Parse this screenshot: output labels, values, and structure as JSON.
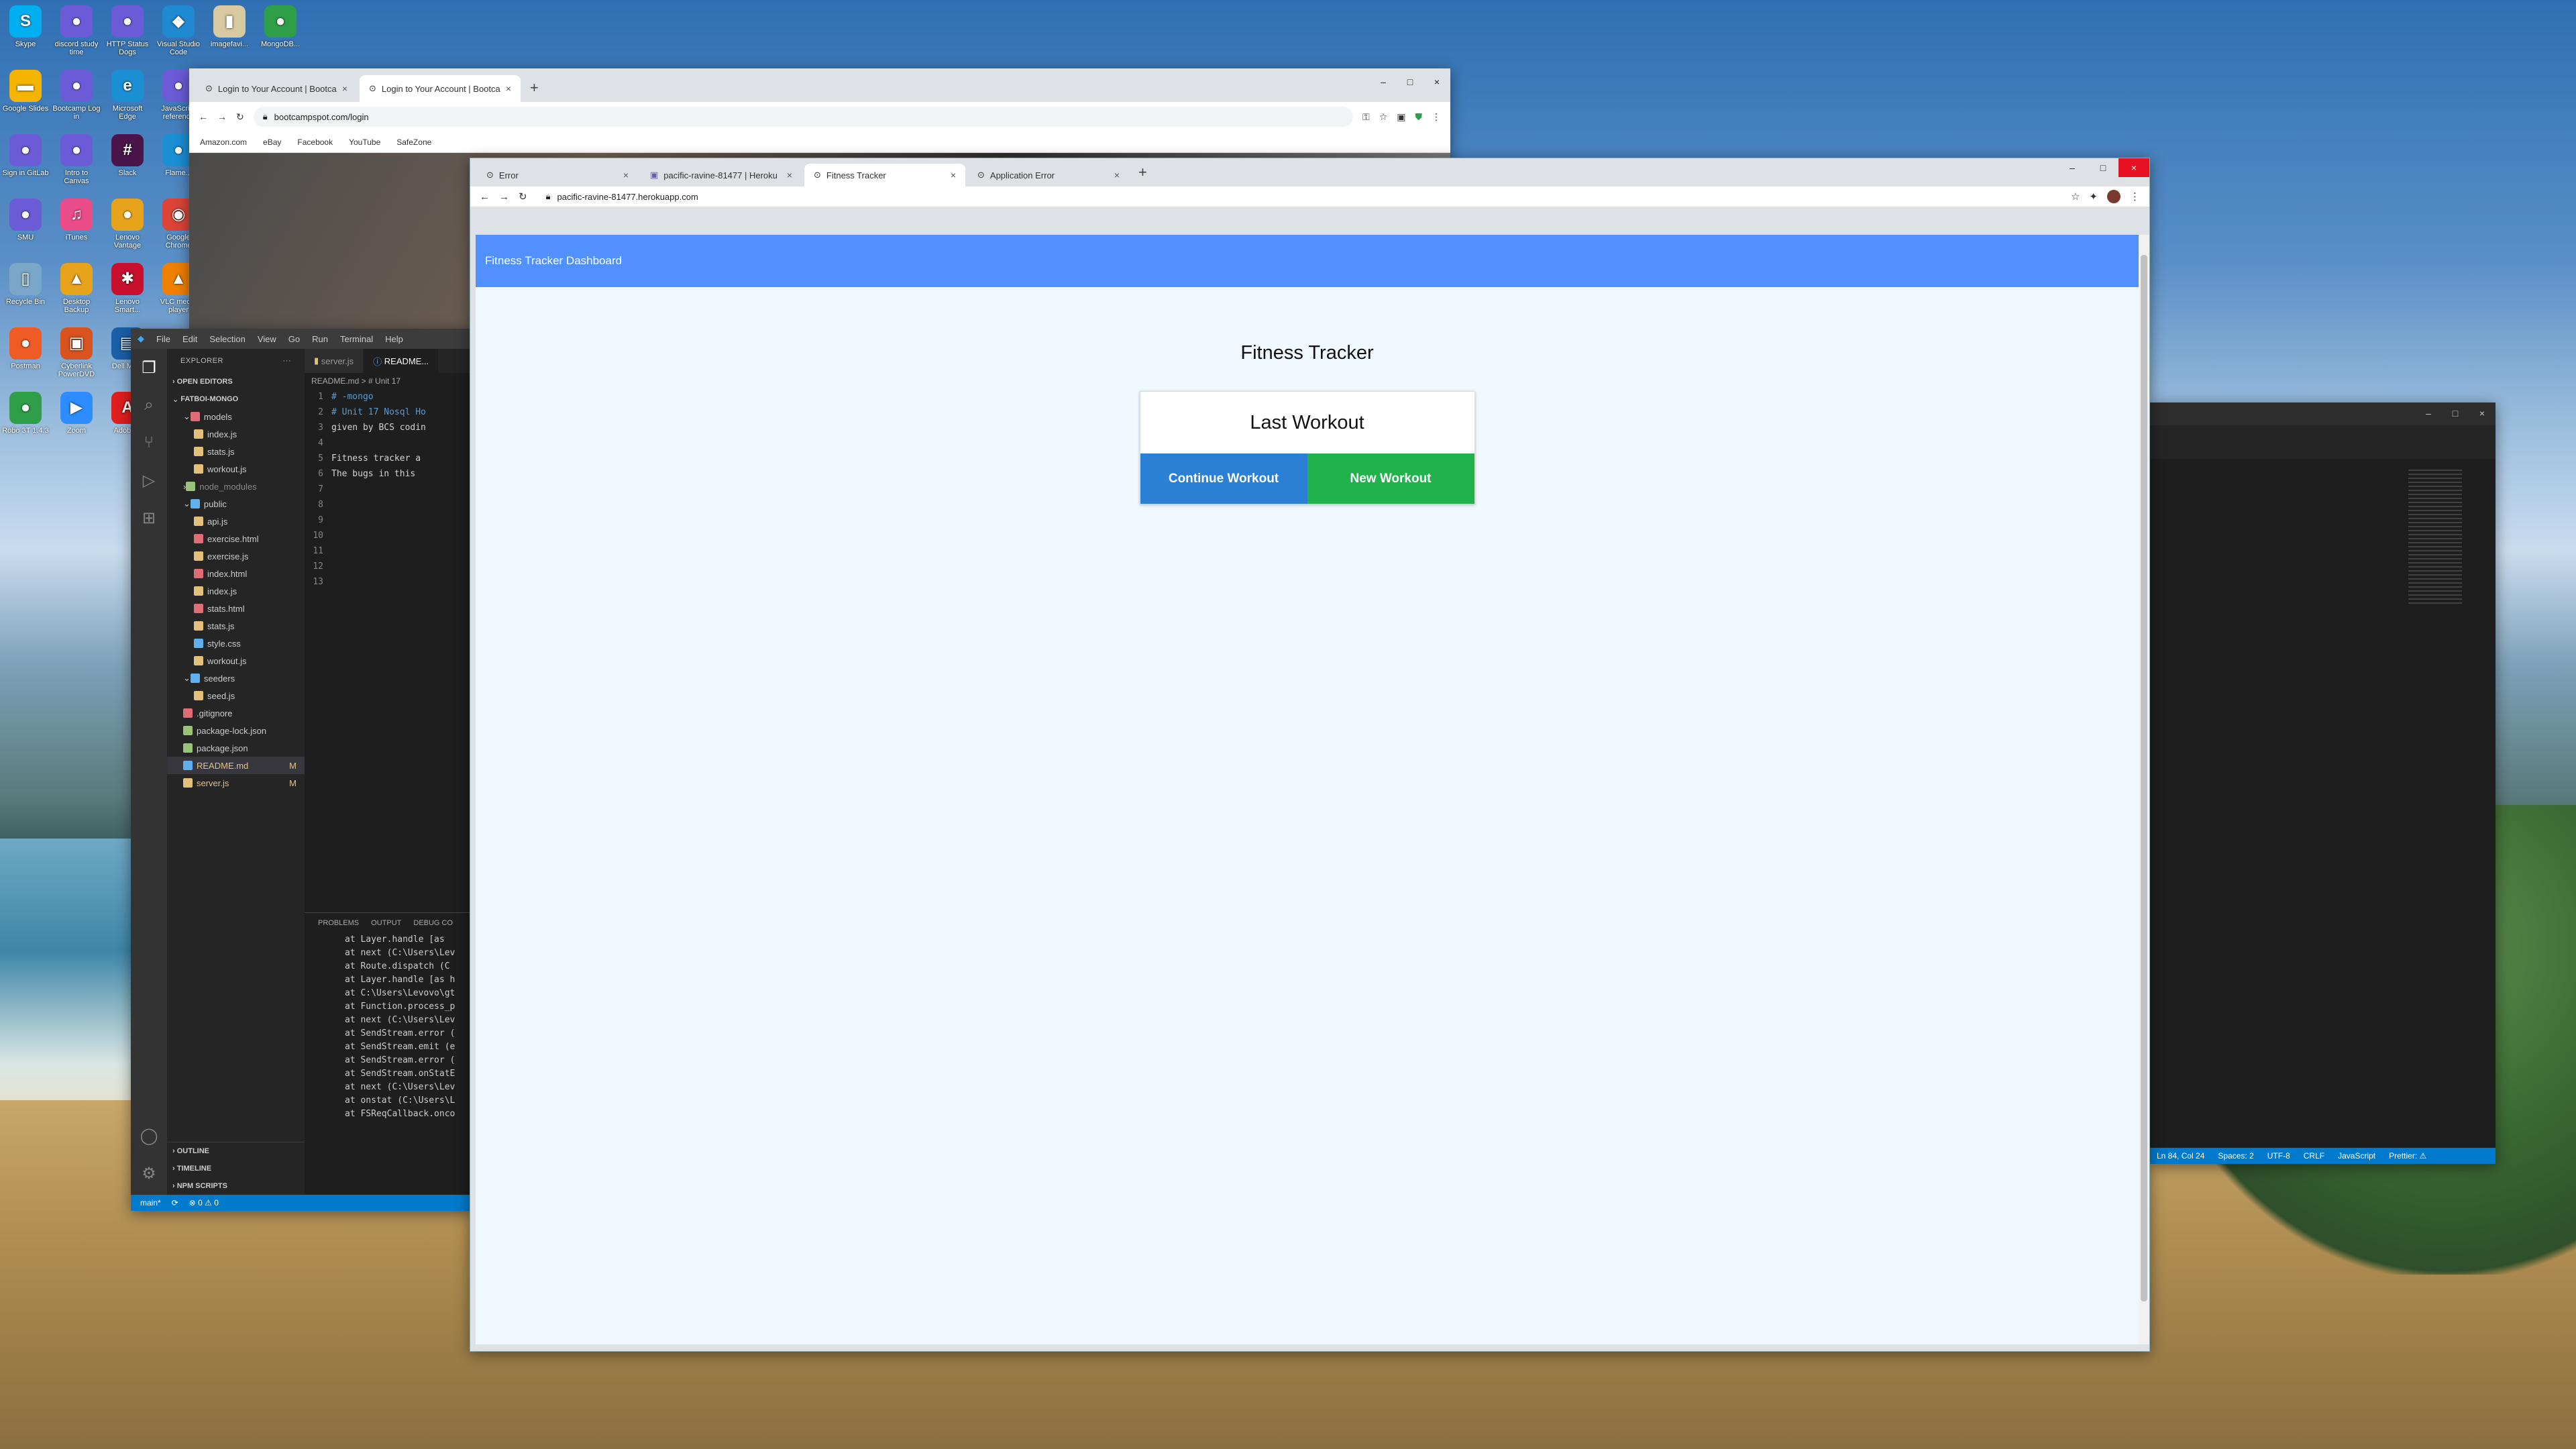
{
  "desktop": {
    "icons": [
      {
        "label": "Skype",
        "glyph": "S",
        "color": "#00aff0"
      },
      {
        "label": "discord study time",
        "glyph": "●",
        "color": "#6b5bd6"
      },
      {
        "label": "HTTP Status Dogs",
        "glyph": "●",
        "color": "#6b5bd6"
      },
      {
        "label": "Visual Studio Code",
        "glyph": "◆",
        "color": "#1f8ad2"
      },
      {
        "label": "imagefavi...",
        "glyph": "▮",
        "color": "#d9c9a0"
      },
      {
        "label": "MongoDB...",
        "glyph": "●",
        "color": "#2e9e48"
      },
      {
        "label": "Google Slides",
        "glyph": "▬",
        "color": "#f4b400"
      },
      {
        "label": "Bootcamp Log in",
        "glyph": "●",
        "color": "#6b5bd6"
      },
      {
        "label": "Microsoft Edge",
        "glyph": "e",
        "color": "#1a8fd4"
      },
      {
        "label": "JavaScript reference",
        "glyph": "●",
        "color": "#6b5bd6"
      },
      {
        "label": "Sign in GitLab",
        "glyph": "●",
        "color": "#6b5bd6"
      },
      {
        "label": "Intro to Canvas",
        "glyph": "●",
        "color": "#6b5bd6"
      },
      {
        "label": "Slack",
        "glyph": "#",
        "color": "#4a154b"
      },
      {
        "label": "Flame...",
        "glyph": "●",
        "color": "#1a8fd4"
      },
      {
        "label": "SMU",
        "glyph": "●",
        "color": "#6b5bd6"
      },
      {
        "label": "iTunes",
        "glyph": "♫",
        "color": "#ea4c89"
      },
      {
        "label": "Lenovo Vantage",
        "glyph": "●",
        "color": "#e8a31c"
      },
      {
        "label": "Google Chrome",
        "glyph": "◉",
        "color": "#db4437"
      },
      {
        "label": "Recycle Bin",
        "glyph": "▯",
        "color": "#7aa7c7"
      },
      {
        "label": "Desktop Backup",
        "glyph": "▲",
        "color": "#e8a31c"
      },
      {
        "label": "Lenovo Smart...",
        "glyph": "✱",
        "color": "#c8102e"
      },
      {
        "label": "VLC media player",
        "glyph": "▲",
        "color": "#f08000"
      },
      {
        "label": "Postman",
        "glyph": "●",
        "color": "#ef5b25"
      },
      {
        "label": "Cyberlink PowerDVD",
        "glyph": "▣",
        "color": "#d9531e"
      },
      {
        "label": "Dell Mo...",
        "glyph": "▤",
        "color": "#1a5fa8"
      },
      {
        "label": "Robo 3T 1.4.3",
        "glyph": "●",
        "color": "#2e9e48"
      },
      {
        "label": "Zoom",
        "glyph": "▶",
        "color": "#2d8cff"
      },
      {
        "label": "Adobe...",
        "glyph": "A",
        "color": "#e01e1e"
      }
    ]
  },
  "chrome_back": {
    "tabs": [
      "Login to Your Account | Bootca",
      "Login to Your Account | Bootca"
    ],
    "url": "bootcampspot.com/login",
    "bookmarks": [
      "Amazon.com",
      "eBay",
      "Facebook",
      "YouTube",
      "SafeZone"
    ]
  },
  "vscode": {
    "menu": [
      "File",
      "Edit",
      "Selection",
      "View",
      "Go",
      "Run",
      "Terminal",
      "Help"
    ],
    "explorer_title": "EXPLORER",
    "open_editors": "OPEN EDITORS",
    "project": "FATBOI-MONGO",
    "tree": [
      {
        "label": "models",
        "level": 1,
        "folder": true,
        "color": "#e06c75"
      },
      {
        "label": "index.js",
        "level": 2,
        "color": "#e5c07b"
      },
      {
        "label": "stats.js",
        "level": 2,
        "color": "#e5c07b"
      },
      {
        "label": "workout.js",
        "level": 2,
        "color": "#e5c07b"
      },
      {
        "label": "node_modules",
        "level": 1,
        "folder": true,
        "color": "#98c379",
        "dim": true
      },
      {
        "label": "public",
        "level": 1,
        "folder": true,
        "color": "#61afef"
      },
      {
        "label": "api.js",
        "level": 2,
        "color": "#e5c07b"
      },
      {
        "label": "exercise.html",
        "level": 2,
        "color": "#e06c75"
      },
      {
        "label": "exercise.js",
        "level": 2,
        "color": "#e5c07b"
      },
      {
        "label": "index.html",
        "level": 2,
        "color": "#e06c75"
      },
      {
        "label": "index.js",
        "level": 2,
        "color": "#e5c07b"
      },
      {
        "label": "stats.html",
        "level": 2,
        "color": "#e06c75"
      },
      {
        "label": "stats.js",
        "level": 2,
        "color": "#e5c07b"
      },
      {
        "label": "style.css",
        "level": 2,
        "color": "#61afef"
      },
      {
        "label": "workout.js",
        "level": 2,
        "color": "#e5c07b"
      },
      {
        "label": "seeders",
        "level": 1,
        "folder": true,
        "color": "#61afef"
      },
      {
        "label": "seed.js",
        "level": 2,
        "color": "#e5c07b"
      },
      {
        "label": ".gitignore",
        "level": 1,
        "color": "#e06c75"
      },
      {
        "label": "package-lock.json",
        "level": 1,
        "color": "#98c379"
      },
      {
        "label": "package.json",
        "level": 1,
        "color": "#98c379"
      },
      {
        "label": "README.md",
        "level": 1,
        "color": "#61afef",
        "selected": true,
        "mod": "M"
      },
      {
        "label": "server.js",
        "level": 1,
        "color": "#e5c07b",
        "mod": "M"
      }
    ],
    "outline": "OUTLINE",
    "timeline": "TIMELINE",
    "npm": "NPM SCRIPTS",
    "tabs": [
      "server.js",
      "README..."
    ],
    "crumb": "README.md > # Unit 17",
    "code": [
      "# -mongo",
      "# Unit 17 Nosql Ho",
      "given by BCS codin",
      "",
      "Fitness tracker a",
      "The bugs in this",
      "",
      "",
      "",
      "",
      "",
      "",
      ""
    ],
    "panel_tabs": [
      "PROBLEMS",
      "OUTPUT",
      "DEBUG CO"
    ],
    "terminal": [
      "at Layer.handle [as",
      "at next (C:\\Users\\Lev",
      "at Route.dispatch (C",
      "at Layer.handle [as h",
      "at C:\\Users\\Levovo\\gt",
      "at Function.process_p",
      "at next (C:\\Users\\Lev",
      "at SendStream.error (",
      "at SendStream.emit (e",
      "at SendStream.error (",
      "at SendStream.onStatE",
      "at next (C:\\Users\\Lev",
      "at onstat (C:\\Users\\L",
      "at FSReqCallback.onco"
    ],
    "status": [
      "main*",
      "⟳",
      "⊗ 0 ⚠ 0"
    ]
  },
  "vscode_right": {
    "status": [
      "Ln 84, Col 24",
      "Spaces: 2",
      "UTF-8",
      "CRLF",
      "JavaScript",
      "Prettier: ⚠"
    ]
  },
  "chrome_main": {
    "tabs": [
      {
        "label": "Error",
        "active": false
      },
      {
        "label": "pacific-ravine-81477 | Heroku",
        "active": false
      },
      {
        "label": "Fitness Tracker",
        "active": true
      },
      {
        "label": "Application Error",
        "active": false
      }
    ],
    "url": "pacific-ravine-81477.herokuapp.com",
    "navbar_title": "Fitness Tracker Dashboard",
    "page_title": "Fitness Tracker",
    "card_title": "Last Workout",
    "continue_label": "Continue Workout",
    "new_label": "New Workout",
    "accent": "#5191ff",
    "continue_color": "#2b7fd4",
    "new_color": "#22b24c"
  }
}
